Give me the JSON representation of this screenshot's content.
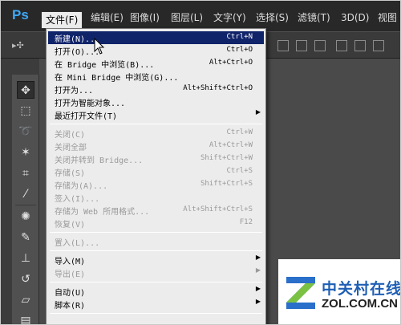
{
  "app": {
    "logo": "Ps"
  },
  "menubar": {
    "items": [
      "文件(F)",
      "编辑(E)",
      "图像(I)",
      "图层(L)",
      "文字(Y)",
      "选择(S)",
      "滤镜(T)",
      "3D(D)",
      "视图"
    ]
  },
  "file_menu": {
    "items": [
      {
        "label": "新建(N)...",
        "shortcut": "Ctrl+N",
        "highlighted": true,
        "enabled": true
      },
      {
        "label": "打开(O)...",
        "shortcut": "Ctrl+O",
        "enabled": true
      },
      {
        "label": "在 Bridge 中浏览(B)...",
        "shortcut": "Alt+Ctrl+O",
        "enabled": true
      },
      {
        "label": "在 Mini Bridge 中浏览(G)...",
        "shortcut": "",
        "enabled": true
      },
      {
        "label": "打开为...",
        "shortcut": "Alt+Shift+Ctrl+O",
        "enabled": true
      },
      {
        "label": "打开为智能对象...",
        "shortcut": "",
        "enabled": true
      },
      {
        "label": "最近打开文件(T)",
        "shortcut": "",
        "submenu": true,
        "enabled": true
      },
      {
        "label": "关闭(C)",
        "shortcut": "Ctrl+W",
        "enabled": false
      },
      {
        "label": "关闭全部",
        "shortcut": "Alt+Ctrl+W",
        "enabled": false
      },
      {
        "label": "关闭并转到 Bridge...",
        "shortcut": "Shift+Ctrl+W",
        "enabled": false
      },
      {
        "label": "存储(S)",
        "shortcut": "Ctrl+S",
        "enabled": false
      },
      {
        "label": "存储为(A)...",
        "shortcut": "Shift+Ctrl+S",
        "enabled": false
      },
      {
        "label": "签入(I)...",
        "shortcut": "",
        "enabled": false
      },
      {
        "label": "存储为 Web 所用格式...",
        "shortcut": "Alt+Shift+Ctrl+S",
        "enabled": false
      },
      {
        "label": "恢复(V)",
        "shortcut": "F12",
        "enabled": false
      },
      {
        "label": "置入(L)...",
        "shortcut": "",
        "enabled": false
      },
      {
        "label": "导入(M)",
        "shortcut": "",
        "submenu": true,
        "enabled": true
      },
      {
        "label": "导出(E)",
        "shortcut": "",
        "submenu": true,
        "enabled": false
      },
      {
        "label": "自动(U)",
        "shortcut": "",
        "submenu": true,
        "enabled": true
      },
      {
        "label": "脚本(R)",
        "shortcut": "",
        "submenu": true,
        "enabled": true
      }
    ]
  },
  "watermark": {
    "cn": "中关村在线",
    "en": "ZOL.COM.CN"
  },
  "colors": {
    "highlight": "#10246a",
    "menubar": "#282828",
    "accent": "#3ea8f7"
  }
}
